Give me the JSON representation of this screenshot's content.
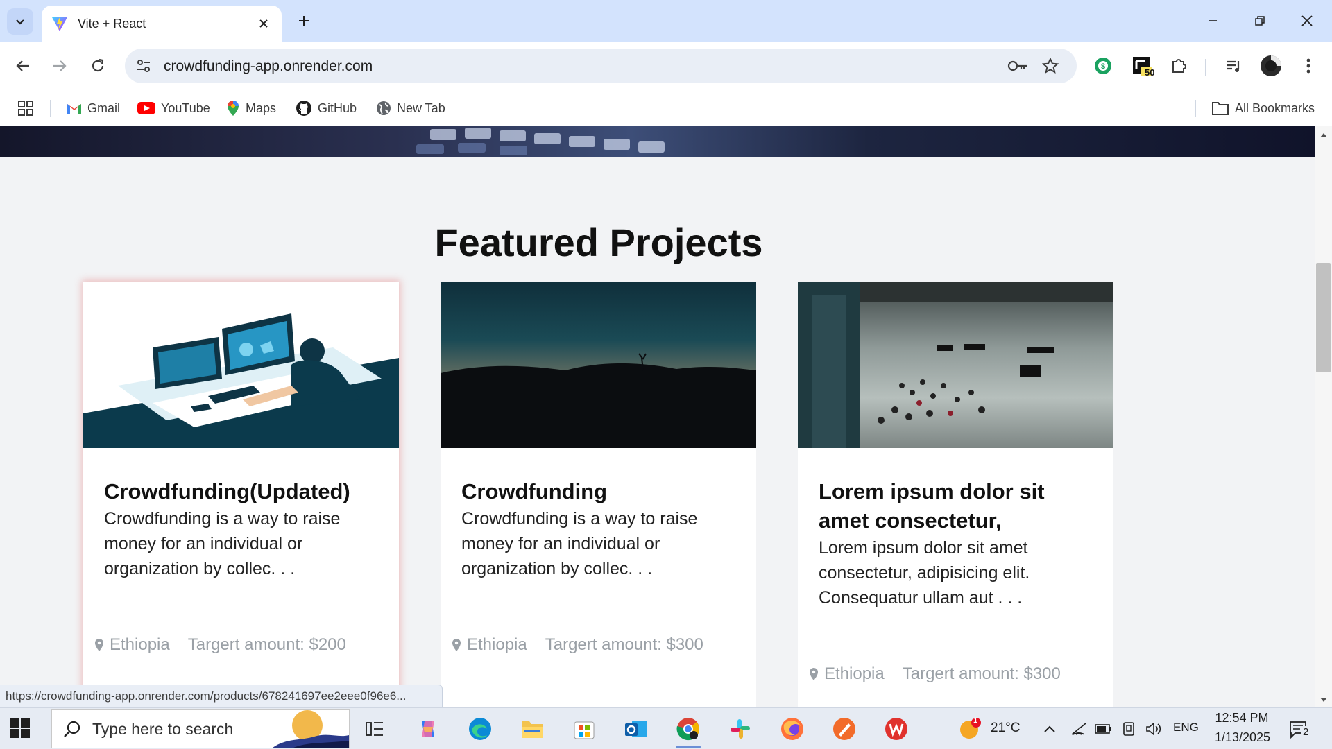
{
  "browser": {
    "tab_title": "Vite + React",
    "url": "crowdfunding-app.onrender.com",
    "bookmarks": [
      {
        "label": "Gmail"
      },
      {
        "label": "YouTube"
      },
      {
        "label": "Maps"
      },
      {
        "label": "GitHub"
      },
      {
        "label": "New Tab"
      }
    ],
    "all_bookmarks_label": "All Bookmarks",
    "extension_badge": "50",
    "status_url": "https://crowdfunding-app.onrender.com/products/678241697ee2eee0f96e6..."
  },
  "page": {
    "section_title": "Featured Projects",
    "projects": [
      {
        "title": "Crowdfunding(Updated)",
        "description": "Crowdfunding is a way to raise money for an individual or organization by collec. . .",
        "location": "Ethiopia",
        "target": "Targert amount: $200"
      },
      {
        "title": "Crowdfunding",
        "description": "Crowdfunding is a way to raise money for an individual or organization by collec. . .",
        "location": "Ethiopia",
        "target": "Targert amount: $300"
      },
      {
        "title": "Lorem ipsum dolor sit amet consectetur,",
        "description": "Lorem ipsum dolor sit amet consectetur, adipisicing elit. Consequatur ullam aut . . .",
        "location": "Ethiopia",
        "target": "Targert amount: $300"
      }
    ]
  },
  "taskbar": {
    "search_placeholder": "Type here to search",
    "weather_temp": "21°C",
    "weather_badge": "1",
    "language": "ENG",
    "time": "12:54 PM",
    "date": "1/13/2025",
    "notification_count": "2"
  }
}
